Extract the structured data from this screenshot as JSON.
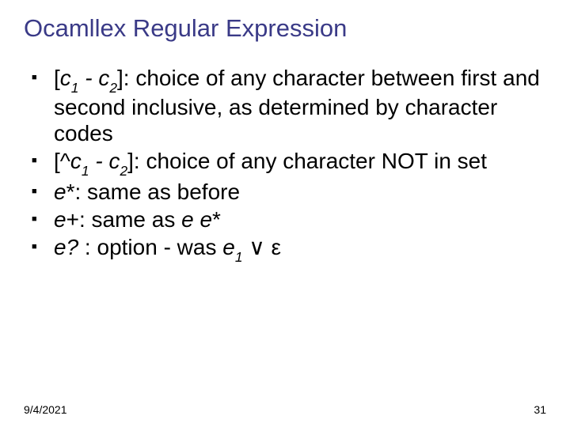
{
  "title": "Ocamllex Regular Expression",
  "bullets": {
    "b1": {
      "pre_open": "[",
      "c1": "c",
      "s1": "1",
      "dash": " - ",
      "c2": "c",
      "s2": "2",
      "close": "]",
      "rest": ": choice of any character between first and second inclusive, as determined by character codes"
    },
    "b2": {
      "pre_open": "[^",
      "c1": "c",
      "s1": "1",
      "dash": " - ",
      "c2": "c",
      "s2": "2",
      "close": "]",
      "rest": ": choice of any character NOT in set"
    },
    "b3": {
      "e": "e",
      "star": "*",
      "rest": ": same as before"
    },
    "b4": {
      "e": "e",
      "plus": "+",
      "rest_pre": ": same as ",
      "e2": "e e",
      "star2": "*"
    },
    "b5": {
      "e": "e",
      "q": "?",
      "colon": " :",
      "rest_pre": " option - was ",
      "e1": "e",
      "s1": "1",
      "or": " ∨ ",
      "eps": "ε"
    }
  },
  "footer": {
    "date": "9/4/2021",
    "page": "31"
  }
}
